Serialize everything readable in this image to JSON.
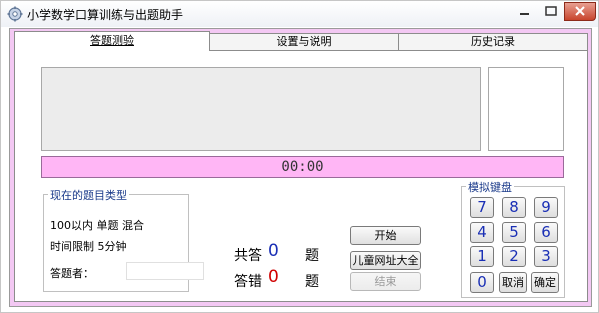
{
  "window": {
    "title": "小学数学口算训练与出题助手"
  },
  "tabs": [
    {
      "label": "答题测验",
      "active": true
    },
    {
      "label": "设置与说明",
      "active": false
    },
    {
      "label": "历史记录",
      "active": false
    }
  ],
  "timer": {
    "value": "00:00"
  },
  "question_type_group": {
    "title": "现在的题目类型",
    "line1": "100以内   单题   混合",
    "line2": "时间限制    5分钟",
    "answerer_label": "答题者："
  },
  "stats": {
    "total_label_prefix": "共答",
    "total_value": "0",
    "total_label_suffix": "题",
    "wrong_label_prefix": "答错",
    "wrong_value": "0",
    "wrong_label_suffix": "题"
  },
  "buttons": {
    "start": "开始",
    "kids_sites": "儿童网址大全",
    "end": "结束"
  },
  "keyboard": {
    "title": "模拟键盘",
    "row1": [
      "7",
      "8",
      "9"
    ],
    "row2": [
      "4",
      "5",
      "6"
    ],
    "row3": [
      "1",
      "2",
      "3"
    ],
    "zero": "0",
    "cancel": "取消",
    "confirm": "确定"
  },
  "colors": {
    "client_bg": "#f3c8f3",
    "timer_bg": "#ffb6f5",
    "count_blue": "#1a2fb5",
    "count_red": "#d00000"
  }
}
